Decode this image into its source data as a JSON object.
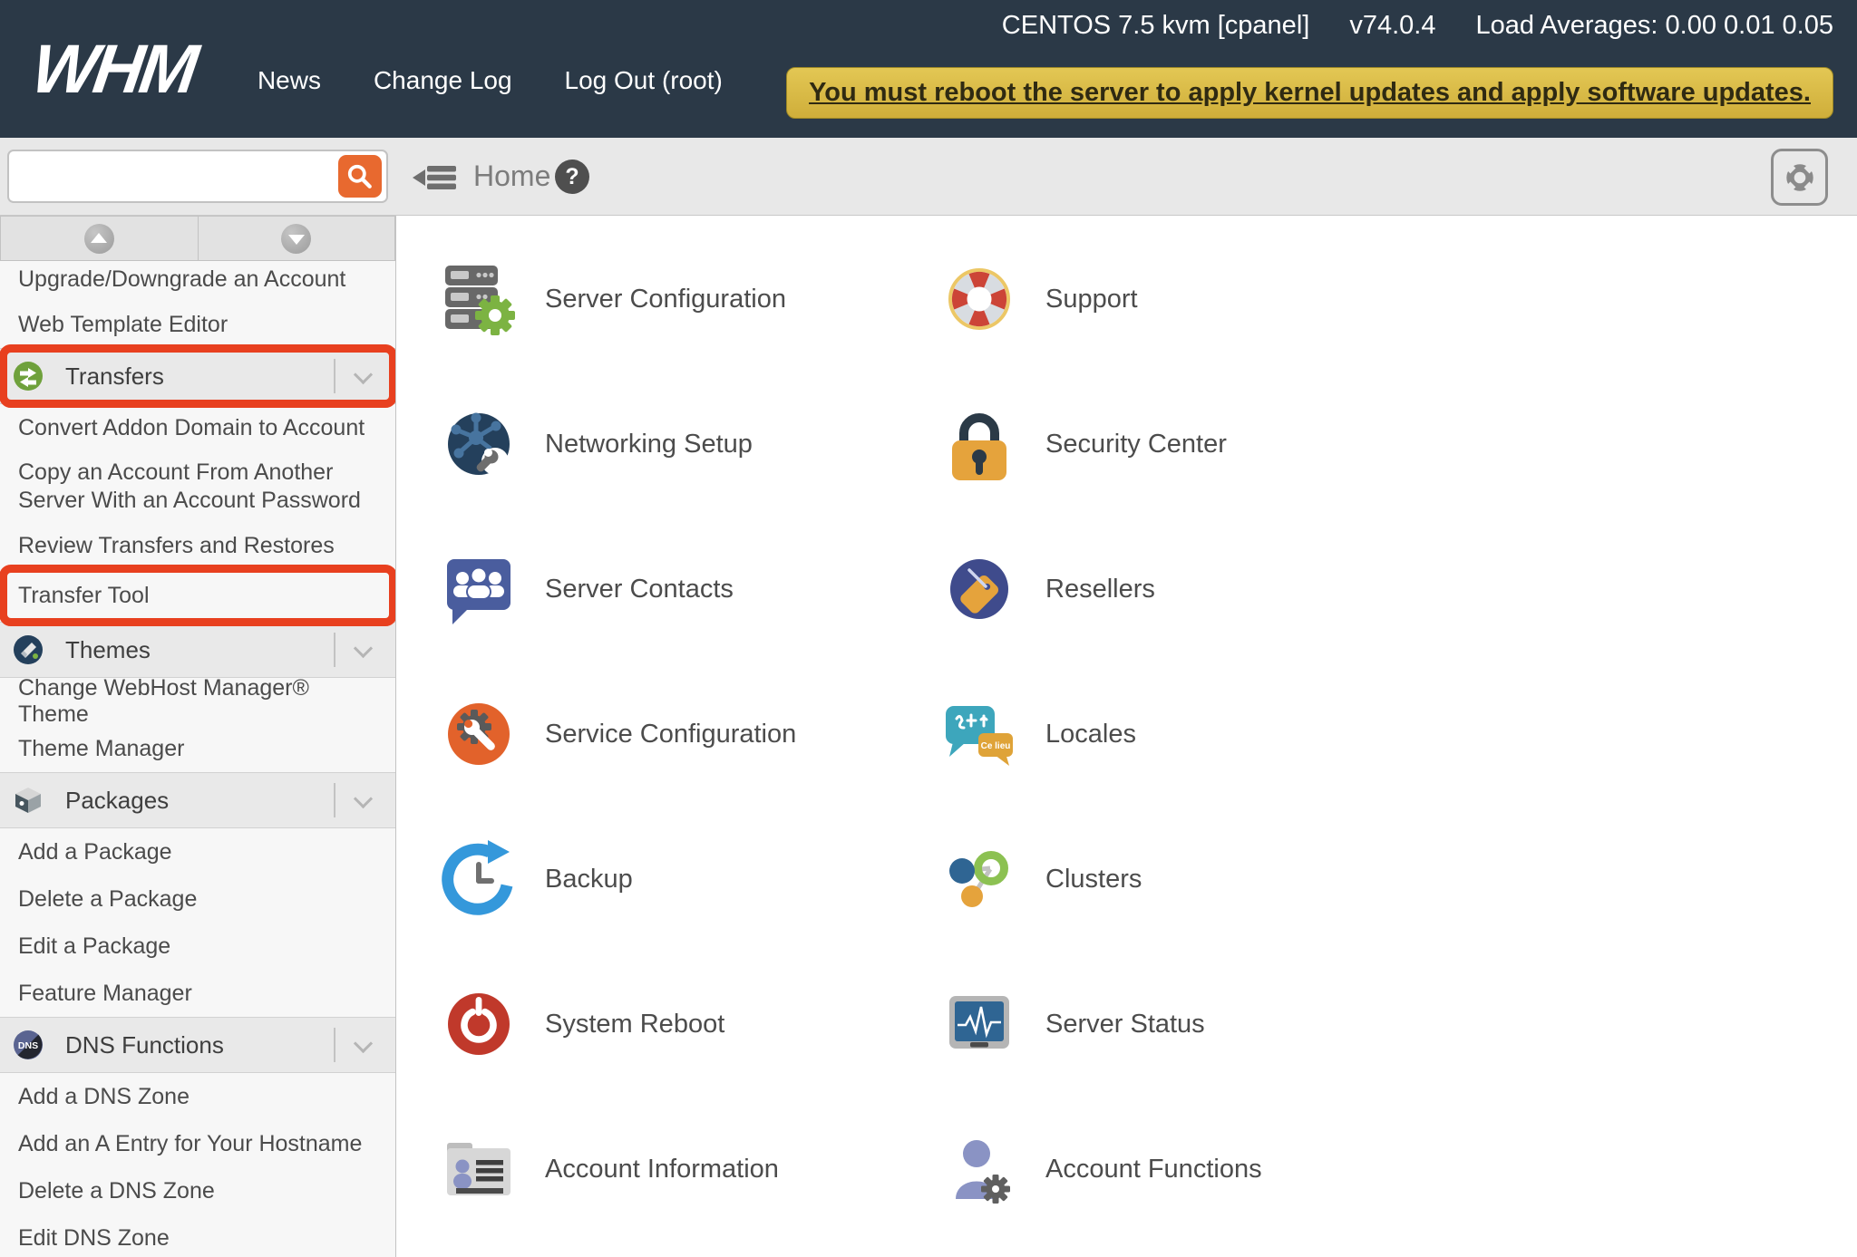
{
  "topbar": {
    "logo": "WHM",
    "nav": [
      {
        "label": "News"
      },
      {
        "label": "Change Log"
      },
      {
        "label": "Log Out (root)"
      }
    ],
    "server_info": "CENTOS 7.5 kvm [cpanel]",
    "version": "v74.0.4",
    "load_averages": "Load Averages: 0.00 0.01 0.05",
    "alert": "You must reboot the server to apply kernel updates and apply software updates."
  },
  "toolbar": {
    "search_value": "",
    "search_placeholder": "",
    "breadcrumb": "Home",
    "help_glyph": "?",
    "icons": {
      "search": "magnifier-icon",
      "collapse": "collapse-menu-icon",
      "help": "question-mark-icon",
      "support": "life-ring-icon"
    }
  },
  "sidebar": {
    "scroll_buttons": {
      "up": "scroll-up-button",
      "down": "scroll-down-button"
    },
    "entries": [
      {
        "label": "Upgrade/Downgrade an Account",
        "type": "item"
      },
      {
        "label": "Web Template Editor",
        "type": "item"
      },
      {
        "label": "Transfers",
        "type": "header",
        "icon": "transfers-icon",
        "highlighted": true
      },
      {
        "label": "Convert Addon Domain to Account",
        "type": "item"
      },
      {
        "label": "Copy an Account From Another Server With an Account Password",
        "type": "item"
      },
      {
        "label": "Review Transfers and Restores",
        "type": "item"
      },
      {
        "label": "Transfer Tool",
        "type": "item",
        "highlighted": true
      },
      {
        "label": "Themes",
        "type": "header",
        "icon": "themes-icon"
      },
      {
        "label": "Change WebHost Manager® Theme",
        "type": "item"
      },
      {
        "label": "Theme Manager",
        "type": "item"
      },
      {
        "label": "Packages",
        "type": "header",
        "icon": "packages-icon"
      },
      {
        "label": "Add a Package",
        "type": "item"
      },
      {
        "label": "Delete a Package",
        "type": "item"
      },
      {
        "label": "Edit a Package",
        "type": "item"
      },
      {
        "label": "Feature Manager",
        "type": "item"
      },
      {
        "label": "DNS Functions",
        "type": "header",
        "icon": "dns-icon"
      },
      {
        "label": "Add a DNS Zone",
        "type": "item"
      },
      {
        "label": "Add an A Entry for Your Hostname",
        "type": "item"
      },
      {
        "label": "Delete a DNS Zone",
        "type": "item"
      },
      {
        "label": "Edit DNS Zone",
        "type": "item"
      }
    ],
    "dns_icon_label": "DNS"
  },
  "main": {
    "tiles": [
      {
        "label": "Server Configuration",
        "icon": "server-configuration-icon"
      },
      {
        "label": "Support",
        "icon": "support-icon"
      },
      {
        "label": "Networking Setup",
        "icon": "networking-setup-icon"
      },
      {
        "label": "Security Center",
        "icon": "security-center-icon"
      },
      {
        "label": "Server Contacts",
        "icon": "server-contacts-icon"
      },
      {
        "label": "Resellers",
        "icon": "resellers-icon"
      },
      {
        "label": "Service Configuration",
        "icon": "service-configuration-icon"
      },
      {
        "label": "Locales",
        "icon": "locales-icon"
      },
      {
        "label": "Backup",
        "icon": "backup-icon"
      },
      {
        "label": "Clusters",
        "icon": "clusters-icon"
      },
      {
        "label": "System Reboot",
        "icon": "system-reboot-icon"
      },
      {
        "label": "Server Status",
        "icon": "server-status-icon"
      },
      {
        "label": "Account Information",
        "icon": "account-information-icon"
      },
      {
        "label": "Account Functions",
        "icon": "account-functions-icon"
      }
    ],
    "locales_icon_text_jp": "こちに",
    "locales_icon_text_fr": "Ce lieu"
  },
  "colors": {
    "navbar": "#2b3947",
    "accent_orange": "#e8692f",
    "annotation_red": "#e8401f",
    "banner_yellow": "#d9bc45",
    "toolbar_gray": "#e8e8e8",
    "sidebar_header_gray": "#e9e9e9",
    "text_dark": "#4b4b4b"
  }
}
